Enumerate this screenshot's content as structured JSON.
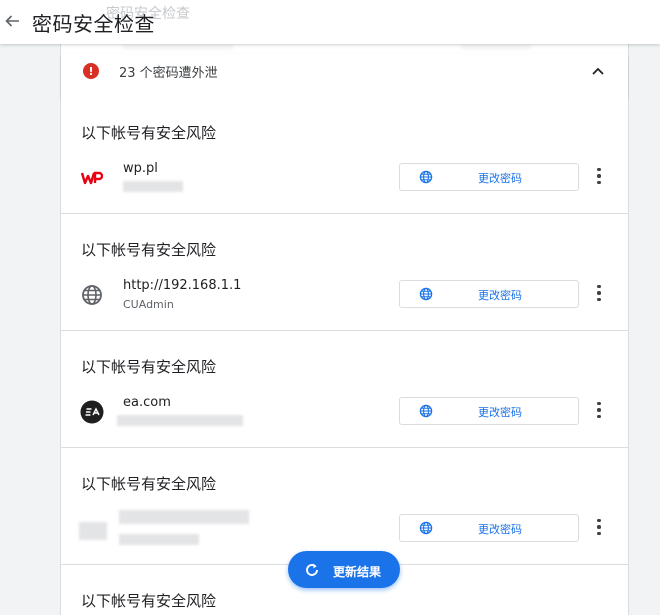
{
  "header": {
    "title": "密码安全检查",
    "ghost_title": "密码安全检查"
  },
  "summary": {
    "text": "23 个密码遭外泄"
  },
  "sections": [
    {
      "heading": "以下帐号有安全风险",
      "site": "wp.pl",
      "username": "",
      "icon": "wp-logo-icon",
      "button": "更改密码"
    },
    {
      "heading": "以下帐号有安全风险",
      "site": "http://192.168.1.1",
      "username": "CUAdmin",
      "icon": "globe-icon",
      "button": "更改密码"
    },
    {
      "heading": "以下帐号有安全风险",
      "site": "ea.com",
      "username": "",
      "icon": "ea-logo-icon",
      "button": "更改密码"
    },
    {
      "heading": "以下帐号有安全风险",
      "site": "",
      "username": "",
      "icon": "blurred-site-icon",
      "button": "更改密码"
    },
    {
      "heading": "以下帐号有安全风险"
    }
  ],
  "fab": {
    "label": "更新结果"
  },
  "colors": {
    "accent": "#1a73e8",
    "alert": "#d93025",
    "wp_brand": "#e60012"
  }
}
